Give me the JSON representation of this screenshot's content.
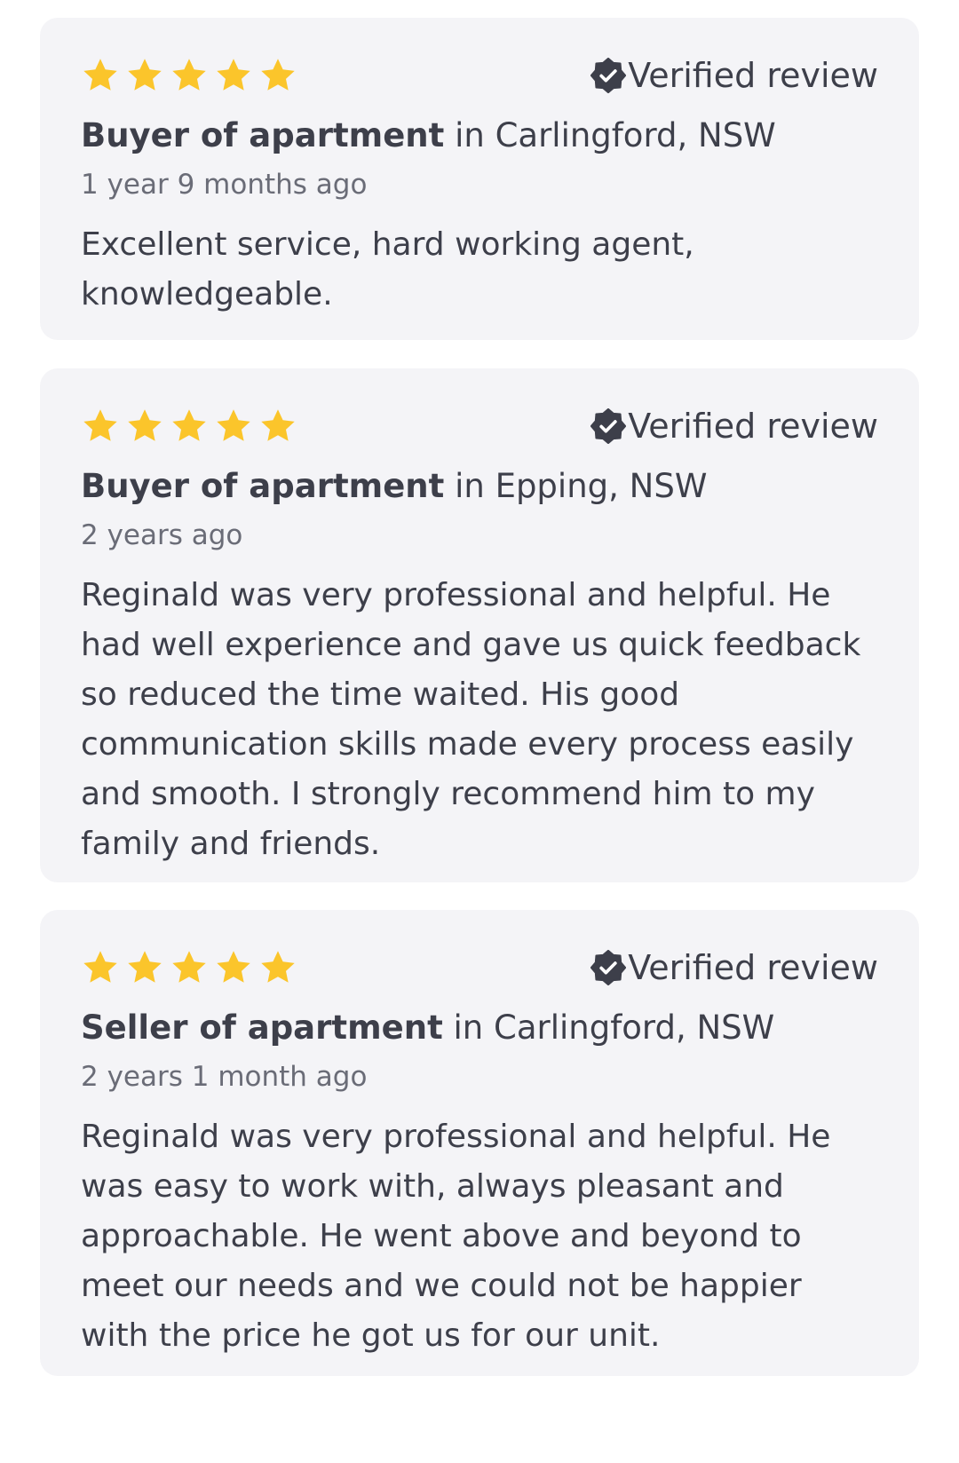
{
  "colors": {
    "star": "#fbc52b",
    "card_background": "#f4f4f7",
    "text": "#3d3f4a",
    "muted_text": "#6a6c77"
  },
  "reviews": [
    {
      "rating": 5,
      "verified_label": "Verified review",
      "verified_icon": "verified-badge-icon",
      "role": "Buyer of apartment",
      "location": " in Carlingford, NSW",
      "time_ago": "1 year 9 months ago",
      "text": "Excellent service, hard working agent, knowledgeable."
    },
    {
      "rating": 5,
      "verified_label": "Verified review",
      "verified_icon": "verified-badge-icon",
      "role": "Buyer of apartment",
      "location": " in Epping, NSW",
      "time_ago": "2 years ago",
      "text": "Reginald was very professional and helpful. He had well experience and gave us quick feedback so reduced the time waited. His good communication skills made every process easily and smooth. I strongly recommend him to my family and friends."
    },
    {
      "rating": 5,
      "verified_label": "Verified review",
      "verified_icon": "verified-badge-icon",
      "role": "Seller of apartment",
      "location": " in Carlingford, NSW",
      "time_ago": "2 years 1 month ago",
      "text": "Reginald was very professional and helpful. He was easy to work with, always pleasant and approachable. He went above and beyond to meet our needs and we could not be happier with the price he got us for our unit."
    }
  ]
}
